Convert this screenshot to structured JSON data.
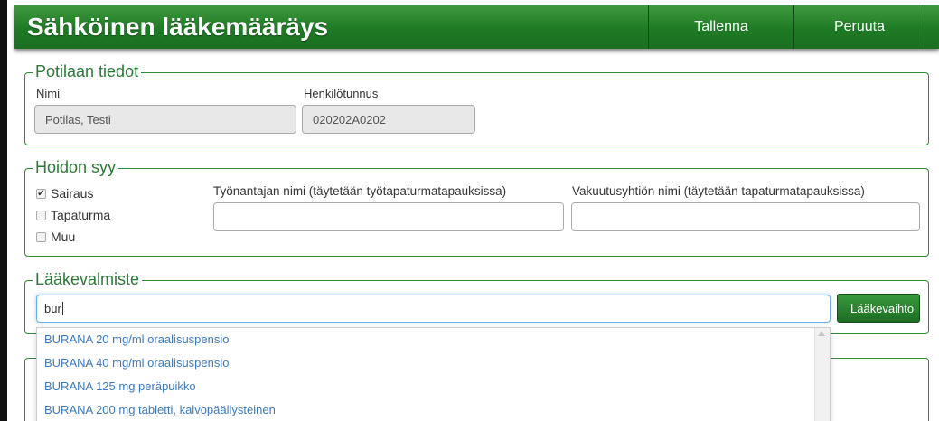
{
  "header": {
    "title": "Sähköinen lääkemääräys",
    "save_label": "Tallenna",
    "cancel_label": "Peruuta"
  },
  "patient": {
    "legend": "Potilaan tiedot",
    "name_label": "Nimi",
    "name_value": "Potilas, Testi",
    "ssn_label": "Henkilötunnus",
    "ssn_value": "020202A0202"
  },
  "reason": {
    "legend": "Hoidon syy",
    "options": [
      {
        "label": "Sairaus",
        "checked": true
      },
      {
        "label": "Tapaturma",
        "checked": false
      },
      {
        "label": "Muu",
        "checked": false
      }
    ],
    "employer_label": "Työnantajan nimi (täytetään työtapaturmatapauksissa)",
    "employer_value": "",
    "insurer_label": "Vakuutusyhtiön nimi (täytetään tapaturmatapauksissa)",
    "insurer_value": ""
  },
  "drug": {
    "legend": "Lääkevalmiste",
    "search_value": "bur",
    "switch_button_label": "Lääkevaihto",
    "suggestions": [
      "BURANA 20 mg/ml oraalisuspensio",
      "BURANA 40 mg/ml oraalisuspensio",
      "BURANA 125 mg peräpuikko",
      "BURANA 200 mg tabletti, kalvopäällysteinen"
    ]
  },
  "colors": {
    "header_green": "#1e7a24",
    "legend_green": "#2b7a36",
    "link_blue": "#3a7bbf"
  }
}
